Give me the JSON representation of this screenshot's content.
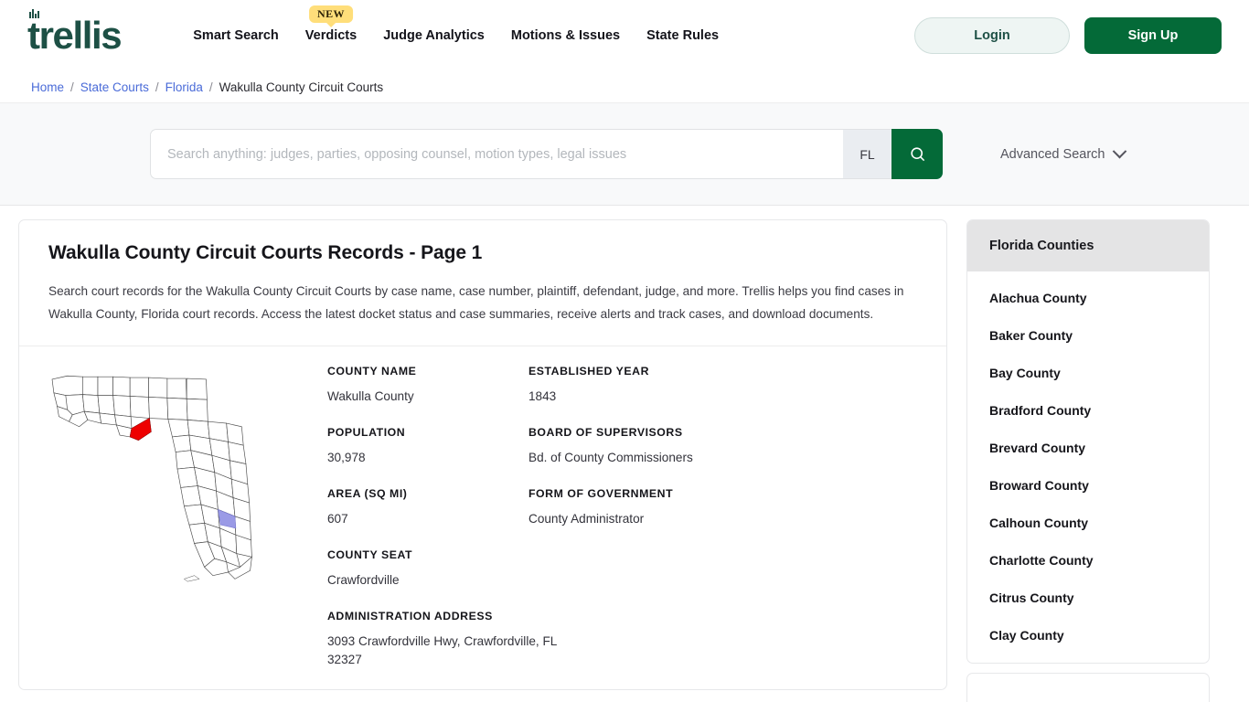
{
  "header": {
    "logo_text": "trellis",
    "nav_items": [
      {
        "label": "Smart Search",
        "badge": null
      },
      {
        "label": "Verdicts",
        "badge": "NEW"
      },
      {
        "label": "Judge Analytics",
        "badge": null
      },
      {
        "label": "Motions & Issues",
        "badge": null
      },
      {
        "label": "State Rules",
        "badge": null
      }
    ],
    "login_label": "Login",
    "signup_label": "Sign Up",
    "brand_color": "#1d5045",
    "accent_color": "#046a38",
    "badge_color": "#ffde7a"
  },
  "breadcrumb": {
    "items": [
      {
        "label": "Home",
        "link": true
      },
      {
        "label": "State Courts",
        "link": true
      },
      {
        "label": "Florida",
        "link": true
      },
      {
        "label": "Wakulla County Circuit Courts",
        "link": false
      }
    ],
    "separator": "/"
  },
  "search": {
    "placeholder": "Search anything: judges, parties, opposing counsel, motion types, legal issues",
    "value": "",
    "state_code": "FL",
    "search_icon": "search-icon",
    "advanced_label": "Advanced Search",
    "advanced_icon": "chevron-down-icon"
  },
  "main": {
    "title": "Wakulla County Circuit Courts Records - Page 1",
    "description": "Search court records for the Wakulla County Circuit Courts by case name, case number, plaintiff, defendant, judge, and more. Trellis helps you find cases in Wakulla County, Florida court records. Access the latest docket status and case summaries, receive alerts and track cases, and download documents.",
    "map": {
      "name": "florida-county-map",
      "highlight_county": "Wakulla County",
      "highlight_color": "#ee0000",
      "secondary_color": "#9a9ae6"
    },
    "fields_left": [
      {
        "label": "COUNTY NAME",
        "value": "Wakulla County"
      },
      {
        "label": "POPULATION",
        "value": "30,978"
      },
      {
        "label": "AREA (SQ MI)",
        "value": "607"
      },
      {
        "label": "COUNTY SEAT",
        "value": "Crawfordville"
      },
      {
        "label": "ADMINISTRATION ADDRESS",
        "value": "3093 Crawfordville Hwy, Crawfordville, FL 32327"
      }
    ],
    "fields_right": [
      {
        "label": "ESTABLISHED YEAR",
        "value": "1843"
      },
      {
        "label": "BOARD OF SUPERVISORS",
        "value": "Bd. of County Commissioners"
      },
      {
        "label": "FORM OF GOVERNMENT",
        "value": "County Administrator"
      }
    ]
  },
  "sidebar": {
    "title": "Florida Counties",
    "items": [
      {
        "label": "Alachua County"
      },
      {
        "label": "Baker County"
      },
      {
        "label": "Bay County"
      },
      {
        "label": "Bradford County"
      },
      {
        "label": "Brevard County"
      },
      {
        "label": "Broward County"
      },
      {
        "label": "Calhoun County"
      },
      {
        "label": "Charlotte County"
      },
      {
        "label": "Citrus County"
      },
      {
        "label": "Clay County"
      }
    ]
  }
}
